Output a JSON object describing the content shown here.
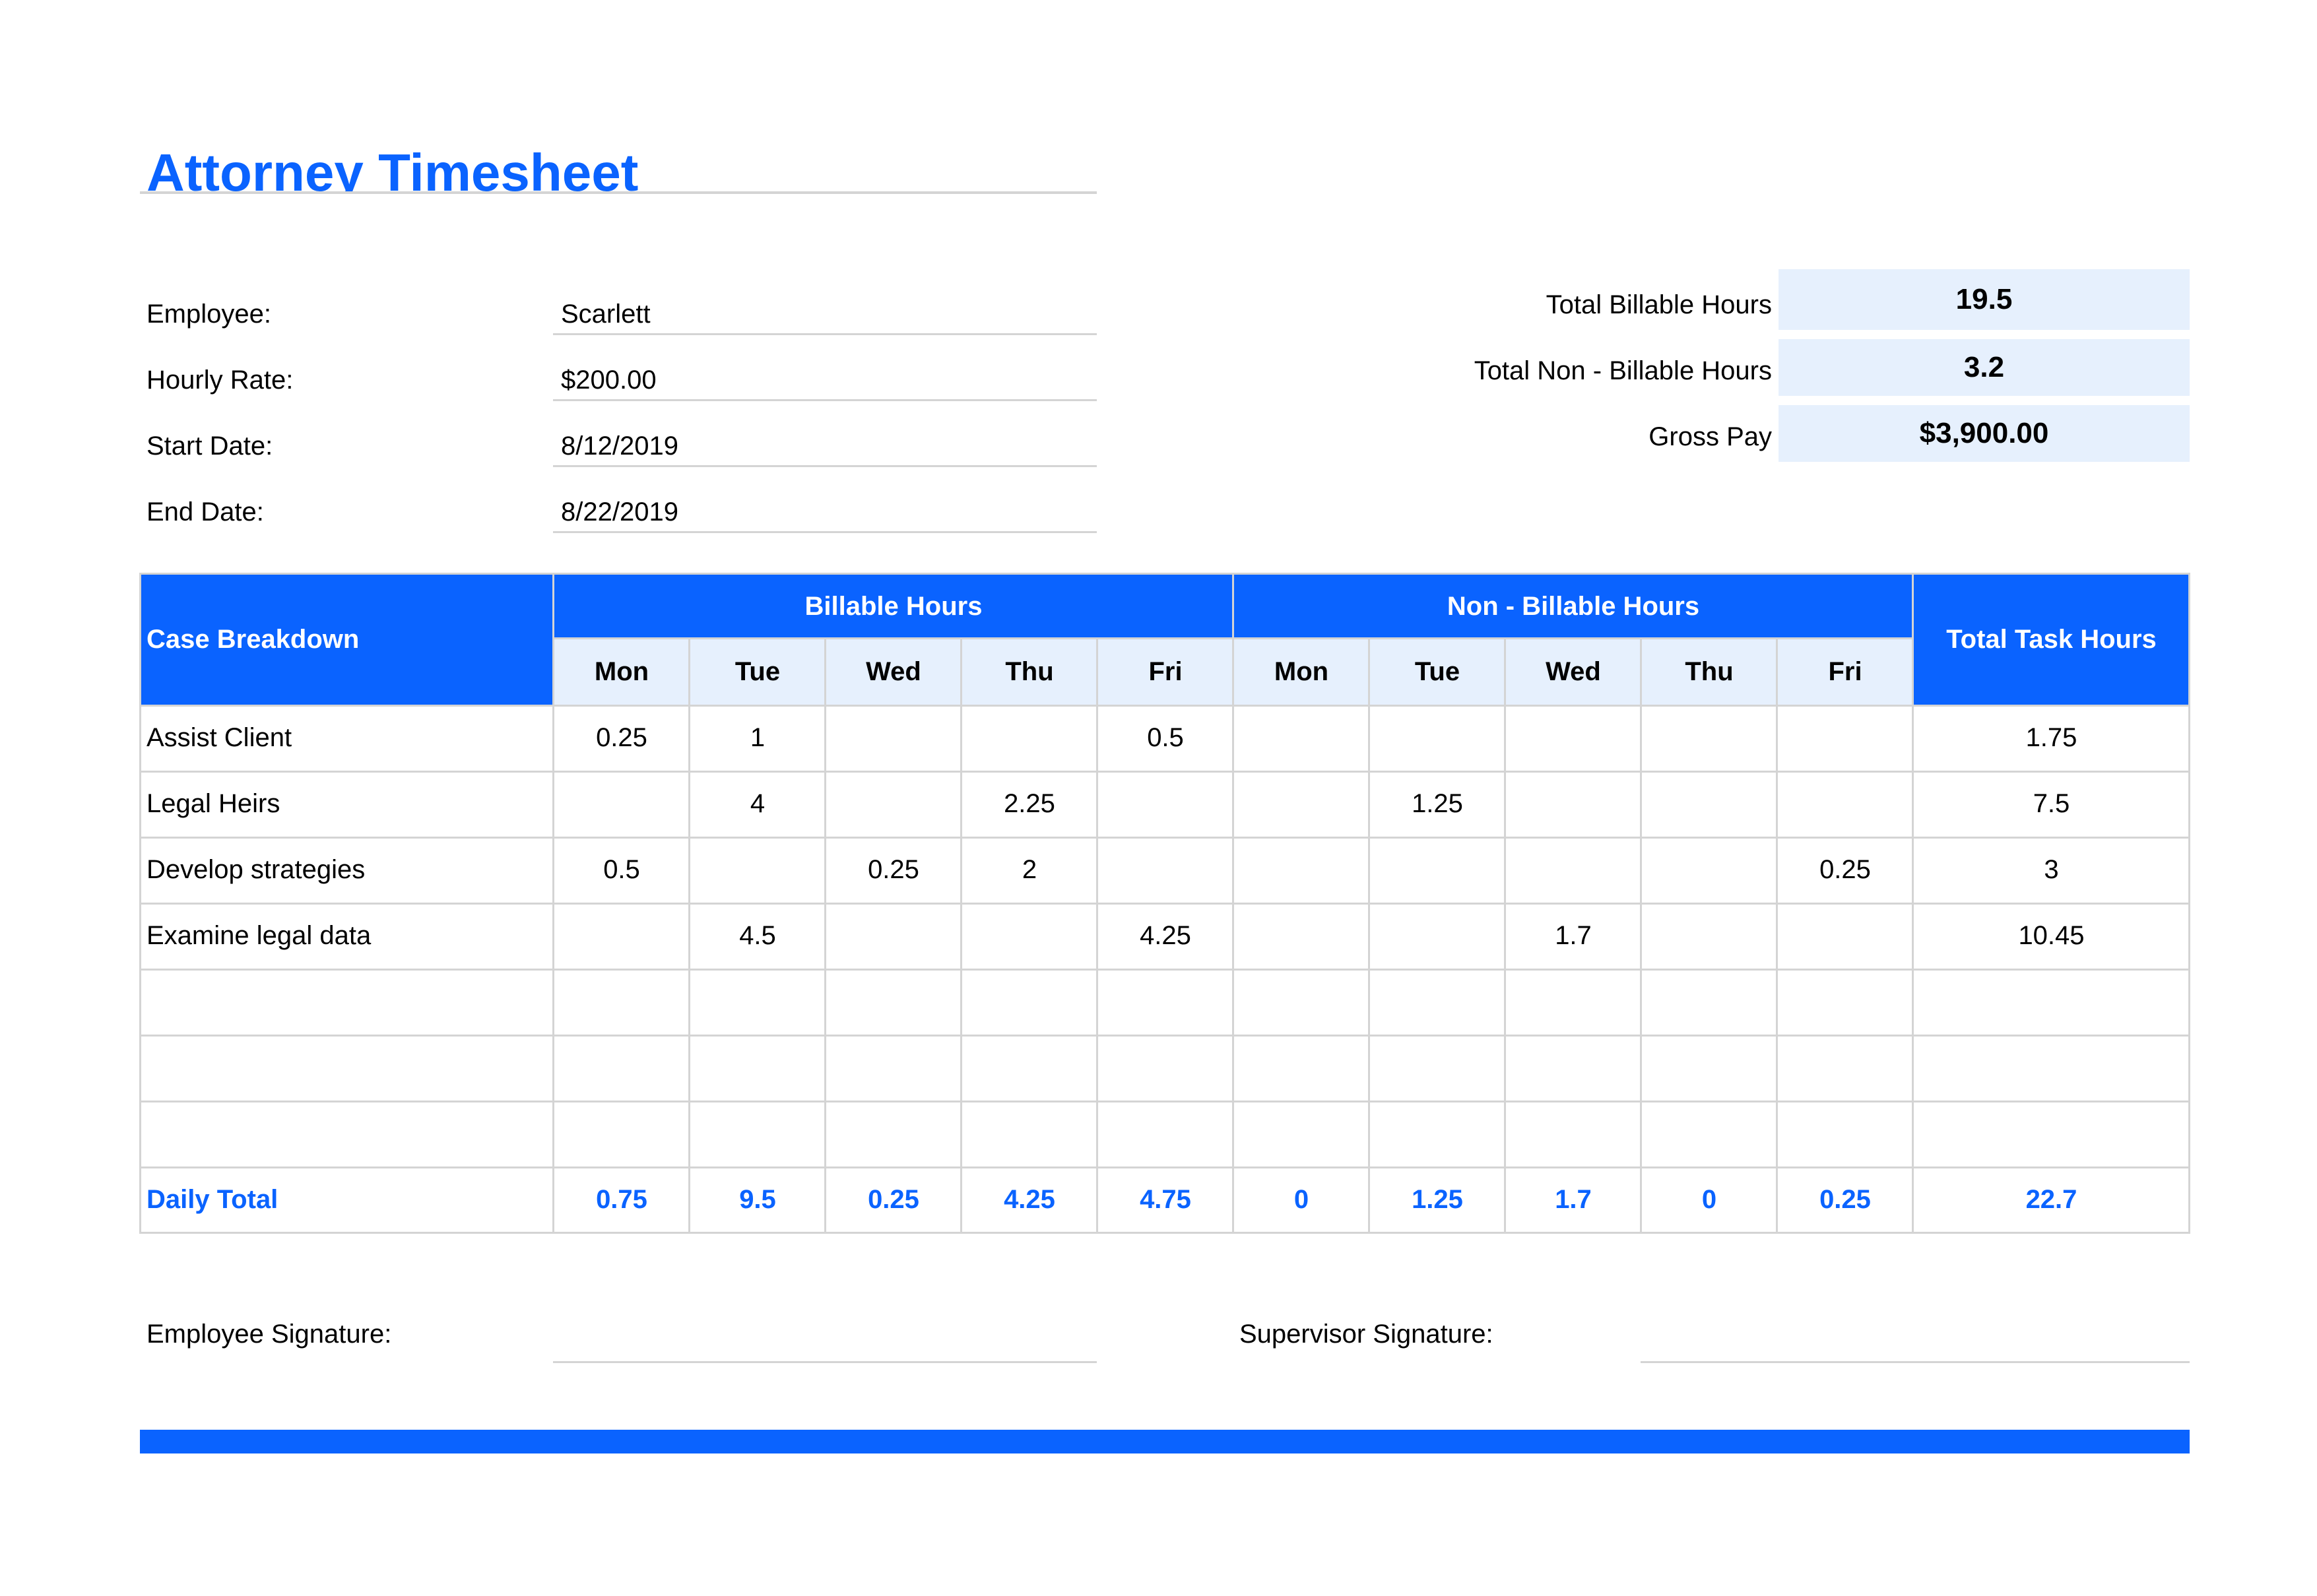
{
  "title": "Attorney Timesheet",
  "info": {
    "employee_label": "Employee:",
    "employee_value": "Scarlett",
    "rate_label": "Hourly Rate:",
    "rate_value": "$200.00",
    "start_label": "Start Date:",
    "start_value": "8/12/2019",
    "end_label": "End Date:",
    "end_value": "8/22/2019"
  },
  "summary": {
    "billable_label": "Total Billable Hours",
    "billable_value": "19.5",
    "nonbillable_label": "Total Non - Billable Hours",
    "nonbillable_value": "3.2",
    "gross_label": "Gross Pay",
    "gross_value": "$3,900.00"
  },
  "table": {
    "case_header": "Case Breakdown",
    "billable_header": "Billable Hours",
    "nonbillable_header": "Non - Billable Hours",
    "total_header": "Total Task Hours",
    "days": [
      "Mon",
      "Tue",
      "Wed",
      "Thu",
      "Fri"
    ],
    "rows": [
      {
        "task": "Assist Client",
        "billable": [
          "0.25",
          "1",
          "",
          "",
          "0.5"
        ],
        "nonbillable": [
          "",
          "",
          "",
          "",
          ""
        ],
        "total": "1.75"
      },
      {
        "task": "Legal Heirs",
        "billable": [
          "",
          "4",
          "",
          "2.25",
          ""
        ],
        "nonbillable": [
          "",
          "1.25",
          "",
          "",
          ""
        ],
        "total": "7.5"
      },
      {
        "task": "Develop strategies",
        "billable": [
          "0.5",
          "",
          "0.25",
          "2",
          ""
        ],
        "nonbillable": [
          "",
          "",
          "",
          "",
          "0.25"
        ],
        "total": "3"
      },
      {
        "task": "Examine legal data",
        "billable": [
          "",
          "4.5",
          "",
          "",
          "4.25"
        ],
        "nonbillable": [
          "",
          "",
          "1.7",
          "",
          ""
        ],
        "total": "10.45"
      },
      {
        "task": "",
        "billable": [
          "",
          "",
          "",
          "",
          ""
        ],
        "nonbillable": [
          "",
          "",
          "",
          "",
          ""
        ],
        "total": ""
      },
      {
        "task": "",
        "billable": [
          "",
          "",
          "",
          "",
          ""
        ],
        "nonbillable": [
          "",
          "",
          "",
          "",
          ""
        ],
        "total": ""
      },
      {
        "task": "",
        "billable": [
          "",
          "",
          "",
          "",
          ""
        ],
        "nonbillable": [
          "",
          "",
          "",
          "",
          ""
        ],
        "total": ""
      }
    ],
    "daily_total_label": "Daily Total",
    "daily_total_billable": [
      "0.75",
      "9.5",
      "0.25",
      "4.25",
      "4.75"
    ],
    "daily_total_nonbillable": [
      "0",
      "1.25",
      "1.7",
      "0",
      "0.25"
    ],
    "daily_total_sum": "22.7"
  },
  "signatures": {
    "employee_label": "Employee Signature:",
    "supervisor_label": "Supervisor Signature:"
  },
  "colors": {
    "accent": "#0a63ff",
    "light_fill": "#e6f0fd",
    "grid_line": "#d4d4d4"
  }
}
